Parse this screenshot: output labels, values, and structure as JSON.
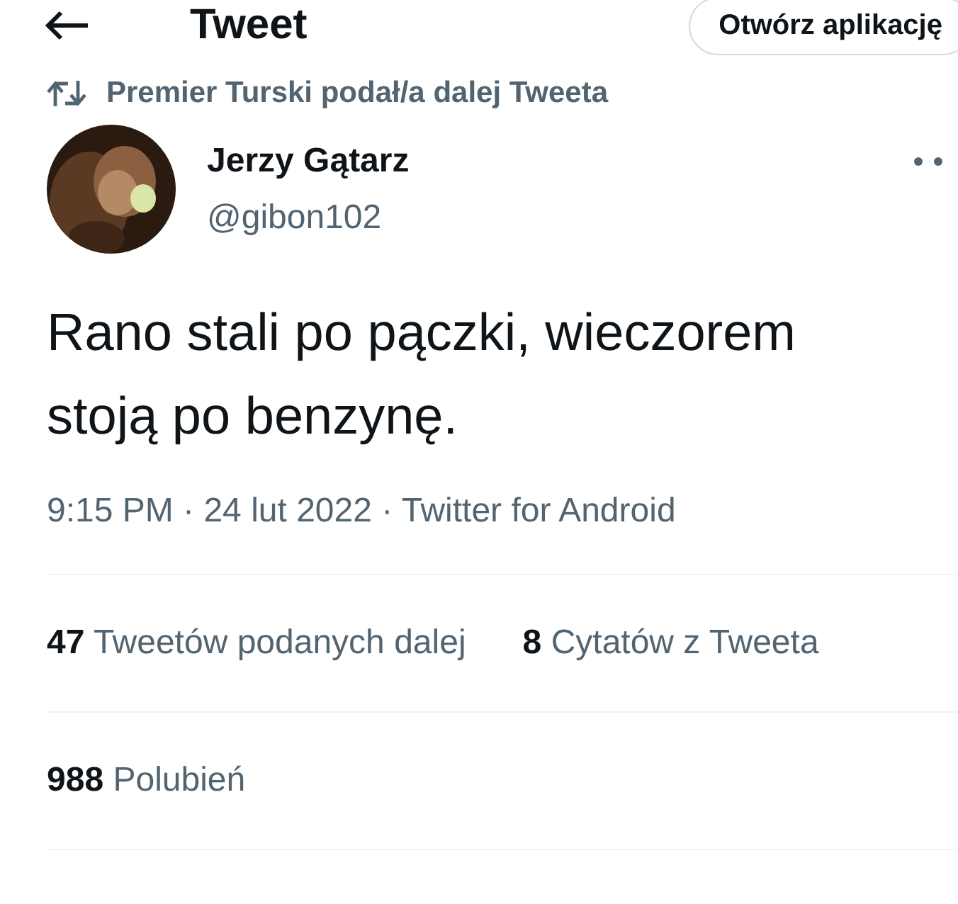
{
  "header": {
    "title": "Tweet",
    "open_app_button": "Otwórz aplikację"
  },
  "retweet_note": "Premier Turski podał/a dalej Tweeta",
  "author": {
    "name": "Jerzy Gątarz",
    "handle": "@gibon102"
  },
  "tweet_text": "Rano stali po pączki, wieczorem stoją po benzynę.",
  "meta": "9:15 PM · 24 lut 2022 · Twitter for Android",
  "stats": [
    {
      "count": "47",
      "label": "Tweetów podanych dalej"
    },
    {
      "count": "8",
      "label": "Cytatów z Tweeta"
    }
  ],
  "likes": {
    "count": "988",
    "label": "Polubień"
  }
}
